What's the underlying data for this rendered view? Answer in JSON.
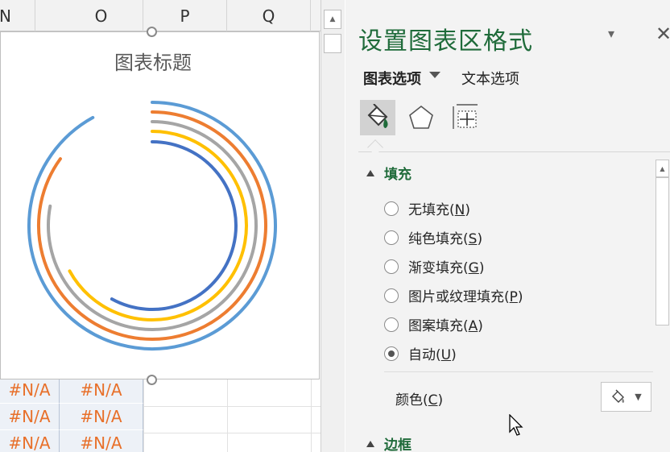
{
  "sheet": {
    "columns": [
      "N",
      "O",
      "P",
      "Q"
    ],
    "na_cells": [
      [
        "#N/A",
        "#N/A"
      ],
      [
        "#N/A",
        "#N/A"
      ],
      [
        "#N/A",
        "#N/A"
      ]
    ]
  },
  "chart": {
    "title": "图表标题",
    "rings": [
      {
        "color": "#5b9bd5",
        "sweep_fraction": 0.92
      },
      {
        "color": "#ed7d31",
        "sweep_fraction": 0.85
      },
      {
        "color": "#a5a5a5",
        "sweep_fraction": 0.78
      },
      {
        "color": "#ffc000",
        "sweep_fraction": 0.67
      },
      {
        "color": "#4472c4",
        "sweep_fraction": 0.58
      }
    ]
  },
  "pane": {
    "title": "设置图表区格式",
    "tabs": {
      "chart_options": "图表选项",
      "text_options": "文本选项"
    },
    "icons": [
      "fill-line-icon",
      "effects-icon",
      "size-properties-icon"
    ],
    "fill_section": {
      "title": "填充",
      "options": [
        {
          "label_prefix": "无填充(",
          "key": "N",
          "label_suffix": ")",
          "checked": false
        },
        {
          "label_prefix": "纯色填充(",
          "key": "S",
          "label_suffix": ")",
          "checked": false
        },
        {
          "label_prefix": "渐变填充(",
          "key": "G",
          "label_suffix": ")",
          "checked": false
        },
        {
          "label_prefix": "图片或纹理填充(",
          "key": "P",
          "label_suffix": ")",
          "checked": false
        },
        {
          "label_prefix": "图案填充(",
          "key": "A",
          "label_suffix": ")",
          "checked": false
        },
        {
          "label_prefix": "自动(",
          "key": "U",
          "label_suffix": ")",
          "checked": true
        }
      ],
      "color_label_prefix": "颜色(",
      "color_key": "C",
      "color_label_suffix": ")"
    },
    "border_section": {
      "title": "边框"
    }
  },
  "colors": {
    "accent_green": "#1f6b3a",
    "error_orange": "#e8702a"
  }
}
